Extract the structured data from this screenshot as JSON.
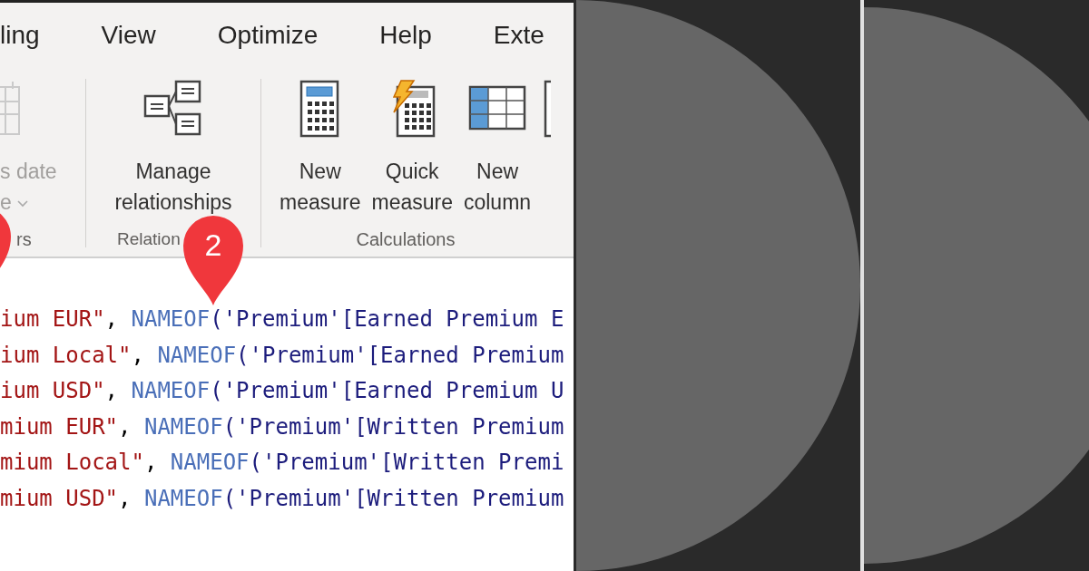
{
  "tabs": [
    {
      "label": "ling"
    },
    {
      "label": "View"
    },
    {
      "label": "Optimize"
    },
    {
      "label": "Help"
    },
    {
      "label": "Exte"
    }
  ],
  "ribbon": {
    "groups": [
      {
        "label": "rs",
        "buttons": [
          {
            "kind": "calendar",
            "lines": [
              "s date",
              "e"
            ],
            "disabled": true,
            "dropdown": true
          }
        ]
      },
      {
        "label": "Relation",
        "buttons": [
          {
            "kind": "relationships",
            "lines": [
              "Manage",
              "relationships"
            ],
            "disabled": false
          }
        ]
      },
      {
        "label": "Calculations",
        "buttons": [
          {
            "kind": "measure",
            "lines": [
              "New",
              "measure"
            ],
            "disabled": false
          },
          {
            "kind": "quick",
            "lines": [
              "Quick",
              "measure"
            ],
            "disabled": false
          },
          {
            "kind": "column",
            "lines": [
              "New",
              "column"
            ],
            "disabled": false
          },
          {
            "kind": "cut"
          }
        ]
      }
    ]
  },
  "markers": [
    {
      "kind": "cut"
    },
    {
      "kind": "full",
      "label": "2"
    }
  ],
  "code": {
    "lines": [
      [
        {
          "kind": "string",
          "text": "ium EUR\""
        },
        {
          "kind": "punct",
          "text": ", "
        },
        {
          "kind": "func",
          "text": "NAMEOF"
        },
        {
          "kind": "ident",
          "text": "('Premium'[Earned Premium E"
        }
      ],
      [
        {
          "kind": "string",
          "text": "ium Local\""
        },
        {
          "kind": "punct",
          "text": ", "
        },
        {
          "kind": "func",
          "text": "NAMEOF"
        },
        {
          "kind": "ident",
          "text": "('Premium'[Earned Premium"
        }
      ],
      [
        {
          "kind": "string",
          "text": "ium USD\""
        },
        {
          "kind": "punct",
          "text": ", "
        },
        {
          "kind": "func",
          "text": "NAMEOF"
        },
        {
          "kind": "ident",
          "text": "('Premium'[Earned Premium U"
        }
      ],
      [
        {
          "kind": "string",
          "text": "mium EUR\""
        },
        {
          "kind": "punct",
          "text": ", "
        },
        {
          "kind": "func",
          "text": "NAMEOF"
        },
        {
          "kind": "ident",
          "text": "('Premium'[Written Premium"
        }
      ],
      [
        {
          "kind": "string",
          "text": "mium Local\""
        },
        {
          "kind": "punct",
          "text": ", "
        },
        {
          "kind": "func",
          "text": "NAMEOF"
        },
        {
          "kind": "ident",
          "text": "('Premium'[Written Premi"
        }
      ],
      [
        {
          "kind": "string",
          "text": "mium USD\""
        },
        {
          "kind": "punct",
          "text": ", "
        },
        {
          "kind": "func",
          "text": "NAMEOF"
        },
        {
          "kind": "ident",
          "text": "('Premium'[Written Premium"
        }
      ]
    ]
  }
}
